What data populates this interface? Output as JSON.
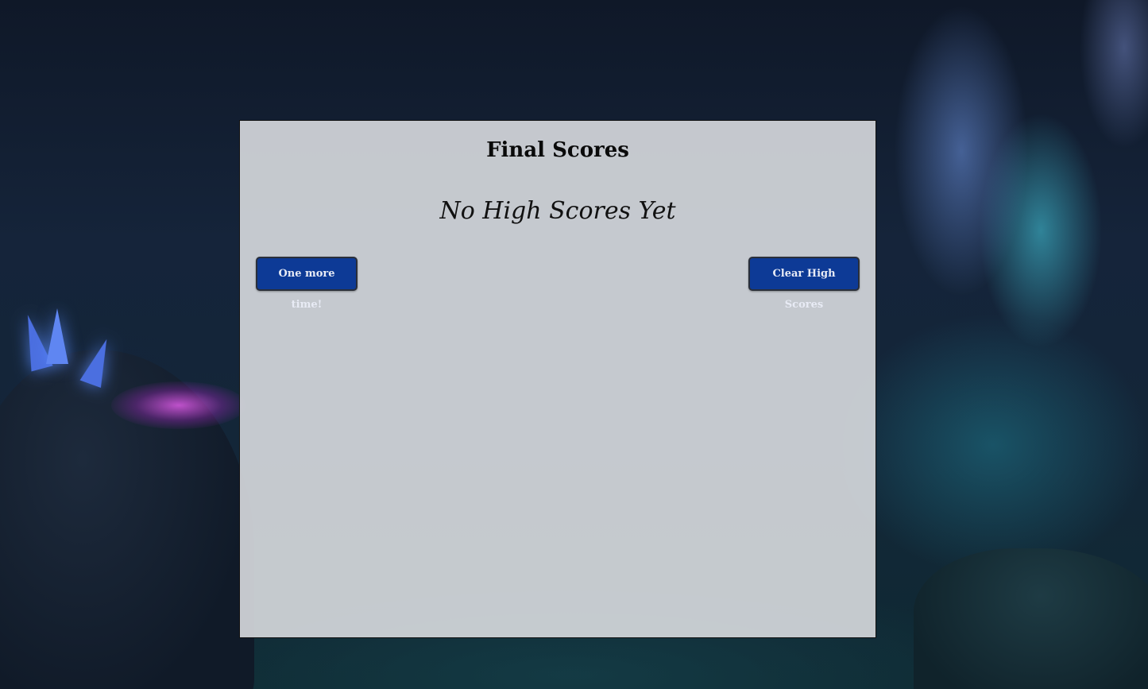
{
  "scores_panel": {
    "title": "Final Scores",
    "empty_message": "No High Scores Yet"
  },
  "actions": {
    "play_again_label": "One more time!",
    "clear_scores_label": "Clear High Scores"
  },
  "colors": {
    "button_bg": "#0d3a96",
    "button_text": "#e8ebf5",
    "panel_bg": "#dedfe3"
  }
}
